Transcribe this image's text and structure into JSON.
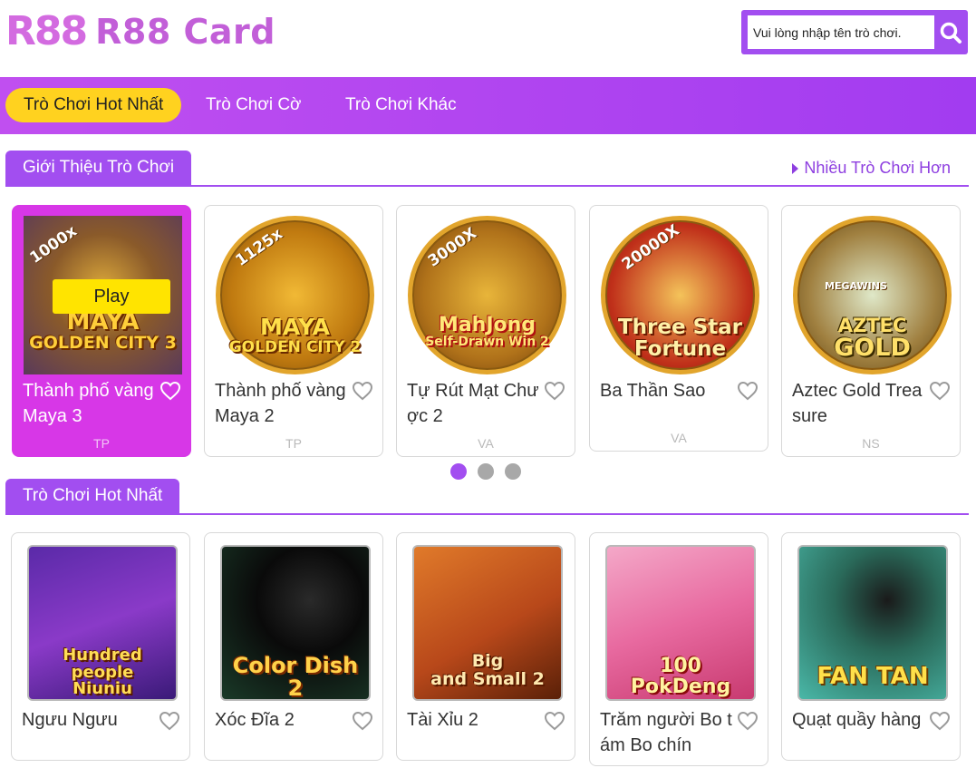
{
  "brand": {
    "mark": "R88",
    "name": "R88 Card"
  },
  "search": {
    "placeholder": "Vui lòng nhập tên trò chơi."
  },
  "nav": {
    "items": [
      "Trò Chơi Hot Nhất",
      "Trò Chơi Cờ",
      "Trò Chơi Khác"
    ]
  },
  "section1": {
    "title": "Giới Thiệu Trò Chơi",
    "more": "Nhiều Trò Chơi Hơn",
    "play_label": "Play",
    "cards": [
      {
        "name": "Thành phố vàng Maya 3",
        "provider": "TP",
        "art": [
          "MAYA",
          "GOLDEN CITY 3"
        ],
        "badge": "1000x"
      },
      {
        "name": "Thành phố vàng Maya 2",
        "provider": "TP",
        "art": [
          "MAYA",
          "GOLDEN CITY 2"
        ],
        "badge": "1125x"
      },
      {
        "name": "Tự Rút Mạt Chược 2",
        "provider": "VA",
        "art": [
          "MahJong",
          "Self-Drawn Win 2"
        ],
        "badge": "3000X"
      },
      {
        "name": "Ba Thần Sao",
        "provider": "VA",
        "art": [
          "Three Star",
          "Fortune"
        ],
        "badge": "20000X"
      },
      {
        "name": "Aztec Gold Treasure",
        "provider": "NS",
        "art": [
          "AZTEC",
          "GOLD"
        ],
        "badge": "MEGAWINS"
      }
    ]
  },
  "pagination": {
    "count": 3,
    "active": 0
  },
  "section2": {
    "title": "Trò Chơi Hot Nhất",
    "cards": [
      {
        "name": "Ngưu Ngưu",
        "art": [
          "Hundred people",
          "Niuniu"
        ]
      },
      {
        "name": "Xóc Đĩa 2",
        "art": [
          "Color Dish 2"
        ]
      },
      {
        "name": "Tài Xỉu 2",
        "art": [
          "Big",
          "and Small 2"
        ]
      },
      {
        "name": "Trăm người Bo tám Bo chín",
        "art": [
          "100 PokDeng"
        ]
      },
      {
        "name": "Quạt quầy hàng",
        "art": [
          "FAN TAN"
        ]
      }
    ]
  },
  "colors": {
    "accent": "#a24ef0",
    "nav": "#b445f0",
    "featured": "#d737e7",
    "highlight": "#ffd21f"
  }
}
